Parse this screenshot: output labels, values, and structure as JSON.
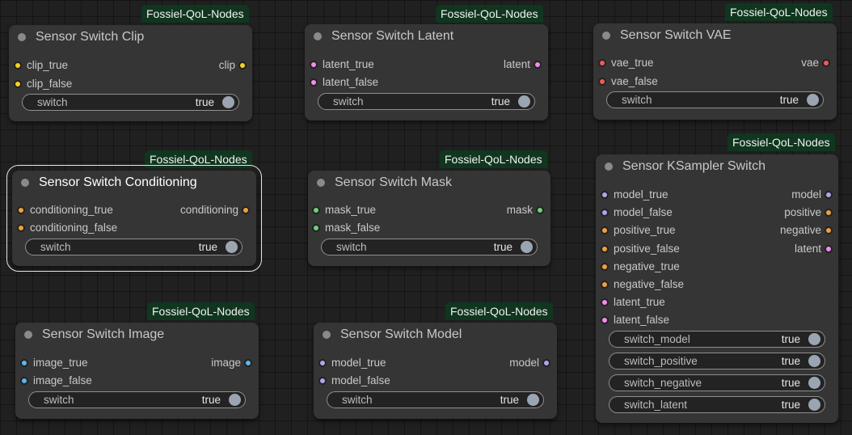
{
  "badge_label": "Fossiel-QoL-Nodes",
  "colors": {
    "clip": "#f6d21b",
    "latent": "#f28cf0",
    "vae": "#ef5a5a",
    "conditioning": "#f1a039",
    "mask": "#6fd07b",
    "image": "#5cb6ef",
    "model": "#b4a3ec",
    "badge_bg": "#10361f"
  },
  "nodes": {
    "clip": {
      "title": "Sensor Switch Clip",
      "inputs": [
        "clip_true",
        "clip_false"
      ],
      "output": "clip",
      "widget": {
        "label": "switch",
        "value": "true"
      }
    },
    "latent": {
      "title": "Sensor Switch Latent",
      "inputs": [
        "latent_true",
        "latent_false"
      ],
      "output": "latent",
      "widget": {
        "label": "switch",
        "value": "true"
      }
    },
    "vae": {
      "title": "Sensor Switch VAE",
      "inputs": [
        "vae_true",
        "vae_false"
      ],
      "output": "vae",
      "widget": {
        "label": "switch",
        "value": "true"
      }
    },
    "conditioning": {
      "title": "Sensor Switch Conditioning",
      "inputs": [
        "conditioning_true",
        "conditioning_false"
      ],
      "output": "conditioning",
      "widget": {
        "label": "switch",
        "value": "true"
      }
    },
    "mask": {
      "title": "Sensor Switch Mask",
      "inputs": [
        "mask_true",
        "mask_false"
      ],
      "output": "mask",
      "widget": {
        "label": "switch",
        "value": "true"
      }
    },
    "image": {
      "title": "Sensor Switch Image",
      "inputs": [
        "image_true",
        "image_false"
      ],
      "output": "image",
      "widget": {
        "label": "switch",
        "value": "true"
      }
    },
    "model": {
      "title": "Sensor Switch Model",
      "inputs": [
        "model_true",
        "model_false"
      ],
      "output": "model",
      "widget": {
        "label": "switch",
        "value": "true"
      }
    },
    "ksampler": {
      "title": "Sensor KSampler Switch",
      "inputs": [
        "model_true",
        "model_false",
        "positive_true",
        "positive_false",
        "negative_true",
        "negative_false",
        "latent_true",
        "latent_false"
      ],
      "outputs": [
        "model",
        "positive",
        "negative",
        "latent"
      ],
      "widgets": [
        {
          "label": "switch_model",
          "value": "true"
        },
        {
          "label": "switch_positive",
          "value": "true"
        },
        {
          "label": "switch_negative",
          "value": "true"
        },
        {
          "label": "switch_latent",
          "value": "true"
        }
      ]
    }
  }
}
